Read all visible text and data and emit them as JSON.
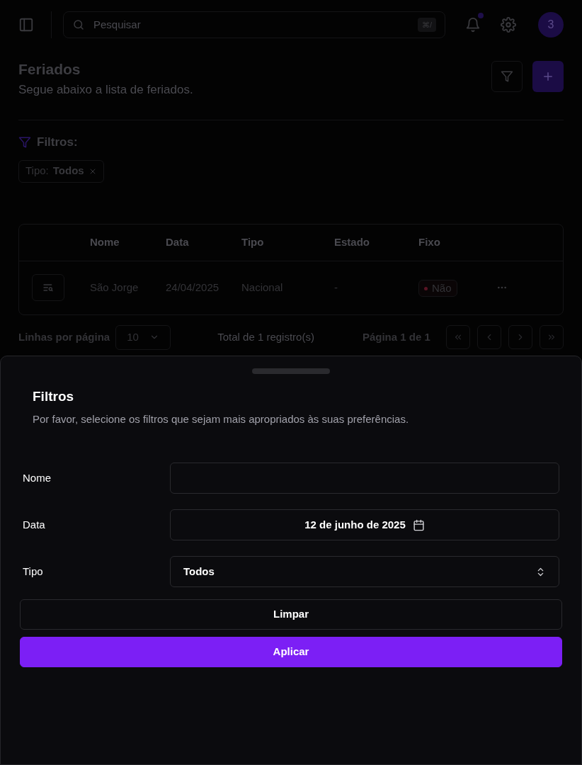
{
  "header": {
    "search": {
      "placeholder": "Pesquisar",
      "shortcut": "⌘/"
    },
    "avatar": "3"
  },
  "page": {
    "title": "Feriados",
    "subtitle": "Segue abaixo a lista de feriados."
  },
  "filters": {
    "label": "Filtros:",
    "chips": [
      {
        "label": "Tipo:",
        "value": "Todos"
      }
    ]
  },
  "table": {
    "columns": [
      "Nome",
      "Data",
      "Tipo",
      "Estado",
      "Fixo"
    ],
    "rows": [
      {
        "cells": [
          "São Jorge",
          "24/04/2025",
          "Nacional",
          "-"
        ],
        "fixo": "Não"
      }
    ]
  },
  "pagination": {
    "rows_label": "Linhas por página",
    "rows_value": "10",
    "total": "Total de 1 registro(s)",
    "page": "Página 1 de 1"
  },
  "drawer": {
    "title": "Filtros",
    "description": "Por favor, selecione os filtros que sejam mais apropriados às suas preferências.",
    "fields": [
      {
        "kind": "text",
        "label": "Nome"
      },
      {
        "kind": "date",
        "label": "Data",
        "value": "12 de junho de 2025"
      },
      {
        "kind": "select",
        "label": "Tipo",
        "value": "Todos"
      }
    ],
    "buttons": [
      {
        "kind": "outline",
        "label": "Limpar"
      },
      {
        "kind": "primary",
        "label": "Aplicar"
      }
    ]
  }
}
